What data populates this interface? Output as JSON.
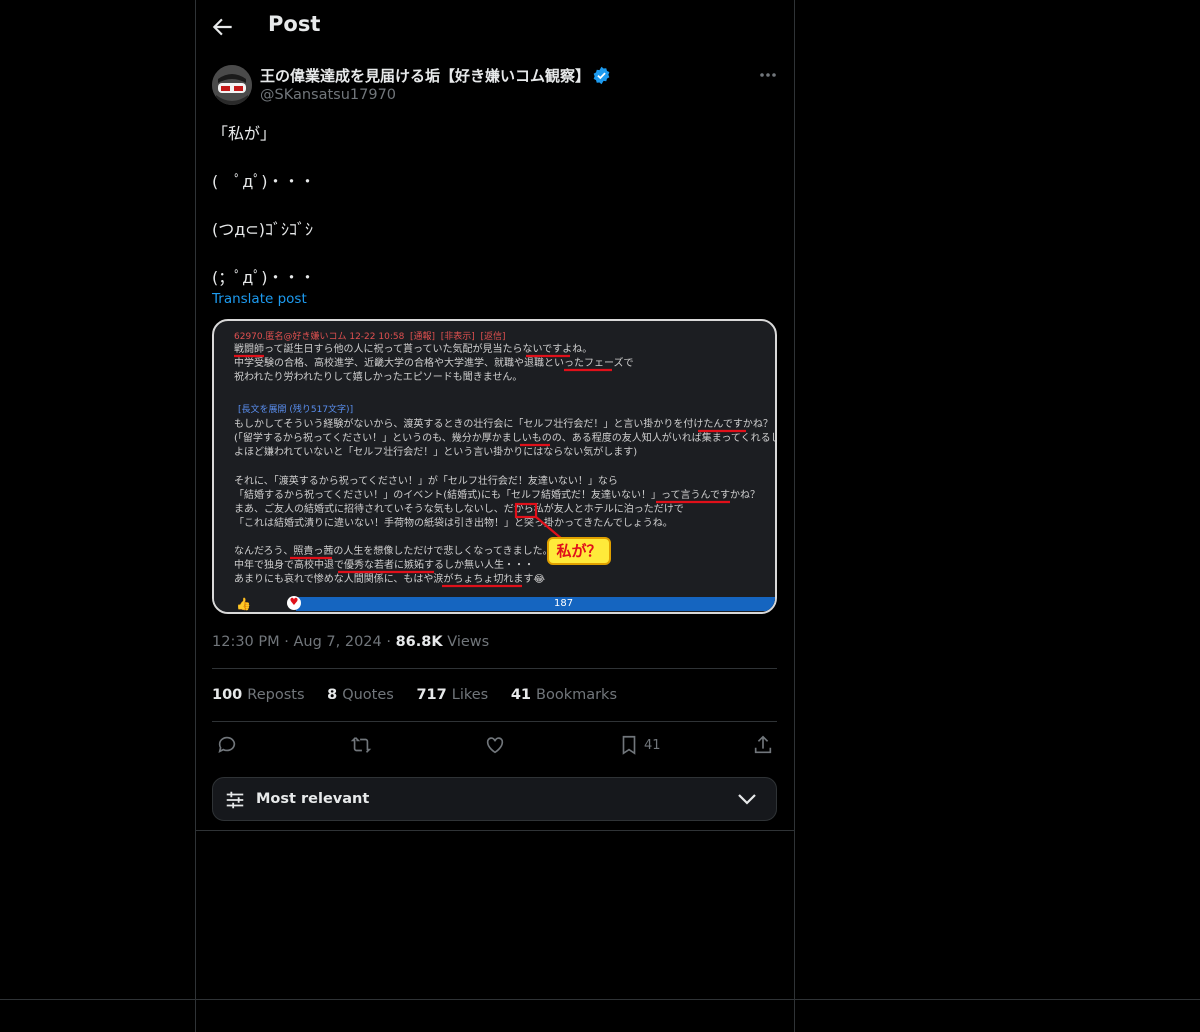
{
  "header": {
    "title": "Post"
  },
  "author": {
    "name": "王の偉業達成を見届ける垢【好き嫌いコム観察】",
    "handle": "@SKansatsu17970"
  },
  "tweet": {
    "lines": [
      "「私が」",
      "(　ﾟдﾟ)・・・",
      "(つд⊂)ｺﾞｼｺﾞｼ",
      "(；ﾟдﾟ)・・・"
    ],
    "translate_label": "Translate post"
  },
  "media": {
    "header_line": "62970.匿名@好き嫌いコム 12-22 10:58  [通報]  [非表示]  [返信]",
    "paragraph1": [
      "戦闘師って誕生日すら他の人に祝って貰っていた気配が見当たらないですよね。",
      "中学受験の合格、高校進学、近畿大学の合格や大学進学、就職や退職といったフェーズで",
      "祝われたり労われたりして嬉しかったエピソードも聞きません。"
    ],
    "expand_link": "[長文を展開 (残り517文字)]",
    "paragraph2": [
      "もしかしてそういう経験がないから、渡英するときの壮行会に「セルフ壮行会だ！」と言い掛かりを付けたんですかね？",
      "(「留学するから祝ってください！」というのも、幾分か厚かましいものの、ある程度の友人知人がいれば集まってくれるし、",
      "よほど嫌われていないと「セルフ壮行会だ！」という言い掛かりにはならない気がします)"
    ],
    "paragraph3": [
      "それに、「渡英するから祝ってください！」が「セルフ壮行会だ！友達いない！」なら",
      "「結婚するから祝ってください！」のイベント(結婚式)にも「セルフ結婚式だ！友達いない！」って言うんですかね？",
      "まあ、ご友人の結婚式に招待されていそうな気もしないし、だから私が友人とホテルに泊っただけで",
      "「これは結婚式潰りに違いない！手荷物の紙袋は引き出物！」と突っ掛かってきたんでしょうね。"
    ],
    "paragraph4": [
      "なんだろう、照貴っ茜の人生を想像しただけで悲しくなってきました。",
      "中年で独身で高校中退で優秀な若者に嫉妬するしか無い人生・・・",
      "あまりにも哀れで惨めな人間関係に、もはや涙がちょちょ切れます😂"
    ],
    "callout": "私が？",
    "like_count": "187"
  },
  "meta": {
    "time": "12:30 PM",
    "date": "Aug 7, 2024",
    "views_count": "86.8K",
    "views_label": "Views"
  },
  "stats": {
    "reposts_count": "100",
    "reposts_label": "Reposts",
    "quotes_count": "8",
    "quotes_label": "Quotes",
    "likes_count": "717",
    "likes_label": "Likes",
    "bookmarks_count": "41",
    "bookmarks_label": "Bookmarks"
  },
  "actions": {
    "bookmark_count": "41"
  },
  "sort": {
    "label": "Most relevant"
  },
  "colors": {
    "accent": "#1d9bf0",
    "text": "#e7e9ea",
    "muted": "#71767b",
    "border": "#2f3336",
    "annotation_red": "#e0101a",
    "callout_yellow": "#ffea3a"
  }
}
